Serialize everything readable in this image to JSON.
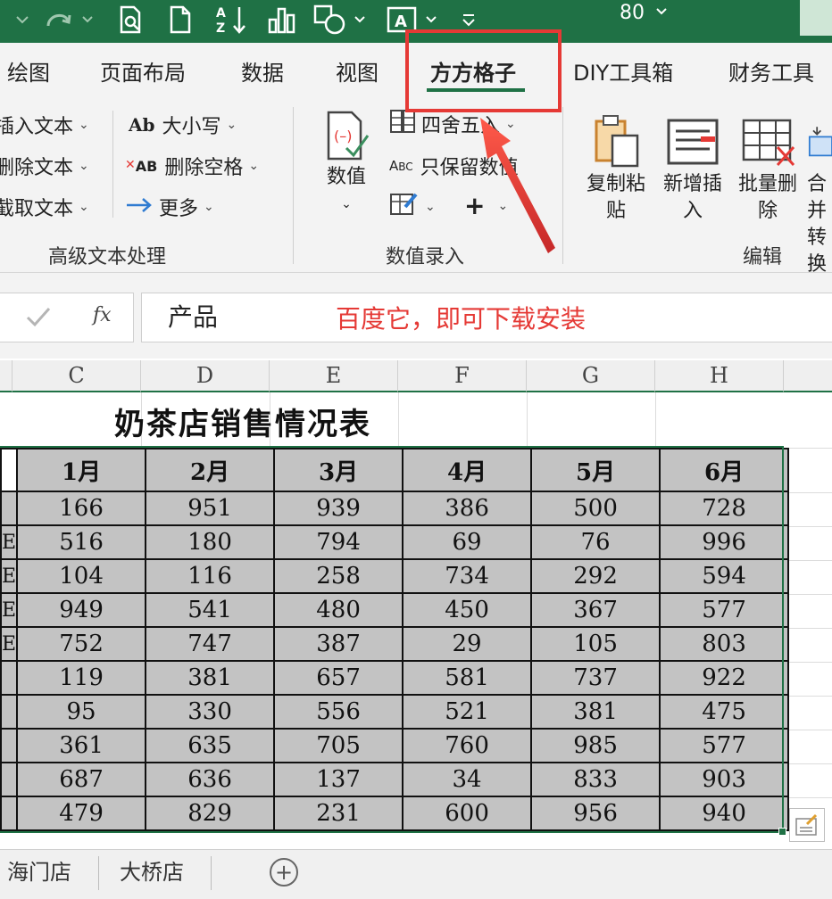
{
  "quick_access": {
    "zoom": "80",
    "icons": [
      "redo-icon",
      "print-preview-icon",
      "new-file-icon",
      "sort-icon",
      "chart-icon",
      "shapes-icon",
      "textbox-icon",
      "customize-icon"
    ]
  },
  "ribbon_tabs": [
    "绘图",
    "页面布局",
    "数据",
    "视图",
    "方方格子",
    "DIY工具箱",
    "财务工具"
  ],
  "active_tab": "方方格子",
  "ribbon": {
    "text_group": {
      "items": [
        "插入文本",
        "删除文本",
        "截取文本"
      ],
      "items_right": [
        "大小写",
        "删除空格",
        "更多"
      ],
      "label": "高级文本处理"
    },
    "number_group": {
      "big_button": "数值",
      "items": [
        "四舍五入",
        "只保留数值"
      ],
      "label": "数值录入"
    },
    "edit_group": {
      "buttons": [
        "复制粘贴",
        "新增插入",
        "批量删除",
        "合并转换"
      ],
      "label": "编辑"
    }
  },
  "formula_bar": {
    "fx": "fx",
    "value": "产品",
    "annotation": "百度它，即可下载安装"
  },
  "columns": [
    "C",
    "D",
    "E",
    "F",
    "G",
    "H"
  ],
  "sheet": {
    "title": "奶茶店销售情况表",
    "headers": [
      "1月",
      "2月",
      "3月",
      "4月",
      "5月",
      "6月"
    ],
    "rows": [
      [
        166,
        951,
        939,
        386,
        500,
        728
      ],
      [
        516,
        180,
        794,
        69,
        76,
        996
      ],
      [
        104,
        116,
        258,
        734,
        292,
        594
      ],
      [
        949,
        541,
        480,
        450,
        367,
        577
      ],
      [
        752,
        747,
        387,
        29,
        105,
        803
      ],
      [
        119,
        381,
        657,
        581,
        737,
        922
      ],
      [
        95,
        330,
        556,
        521,
        381,
        475
      ],
      [
        361,
        635,
        705,
        760,
        985,
        577
      ],
      [
        687,
        636,
        137,
        34,
        833,
        903
      ],
      [
        479,
        829,
        231,
        600,
        956,
        940
      ]
    ],
    "row_edge_marks": [
      "",
      "E",
      "E",
      "E",
      "E",
      "",
      "",
      "",
      "",
      ""
    ]
  },
  "sheet_tabs": [
    "海门店",
    "大桥店"
  ],
  "colors": {
    "accent": "#1f7145",
    "annotation": "#e53935",
    "cell_fill": "#c3c3c3"
  }
}
